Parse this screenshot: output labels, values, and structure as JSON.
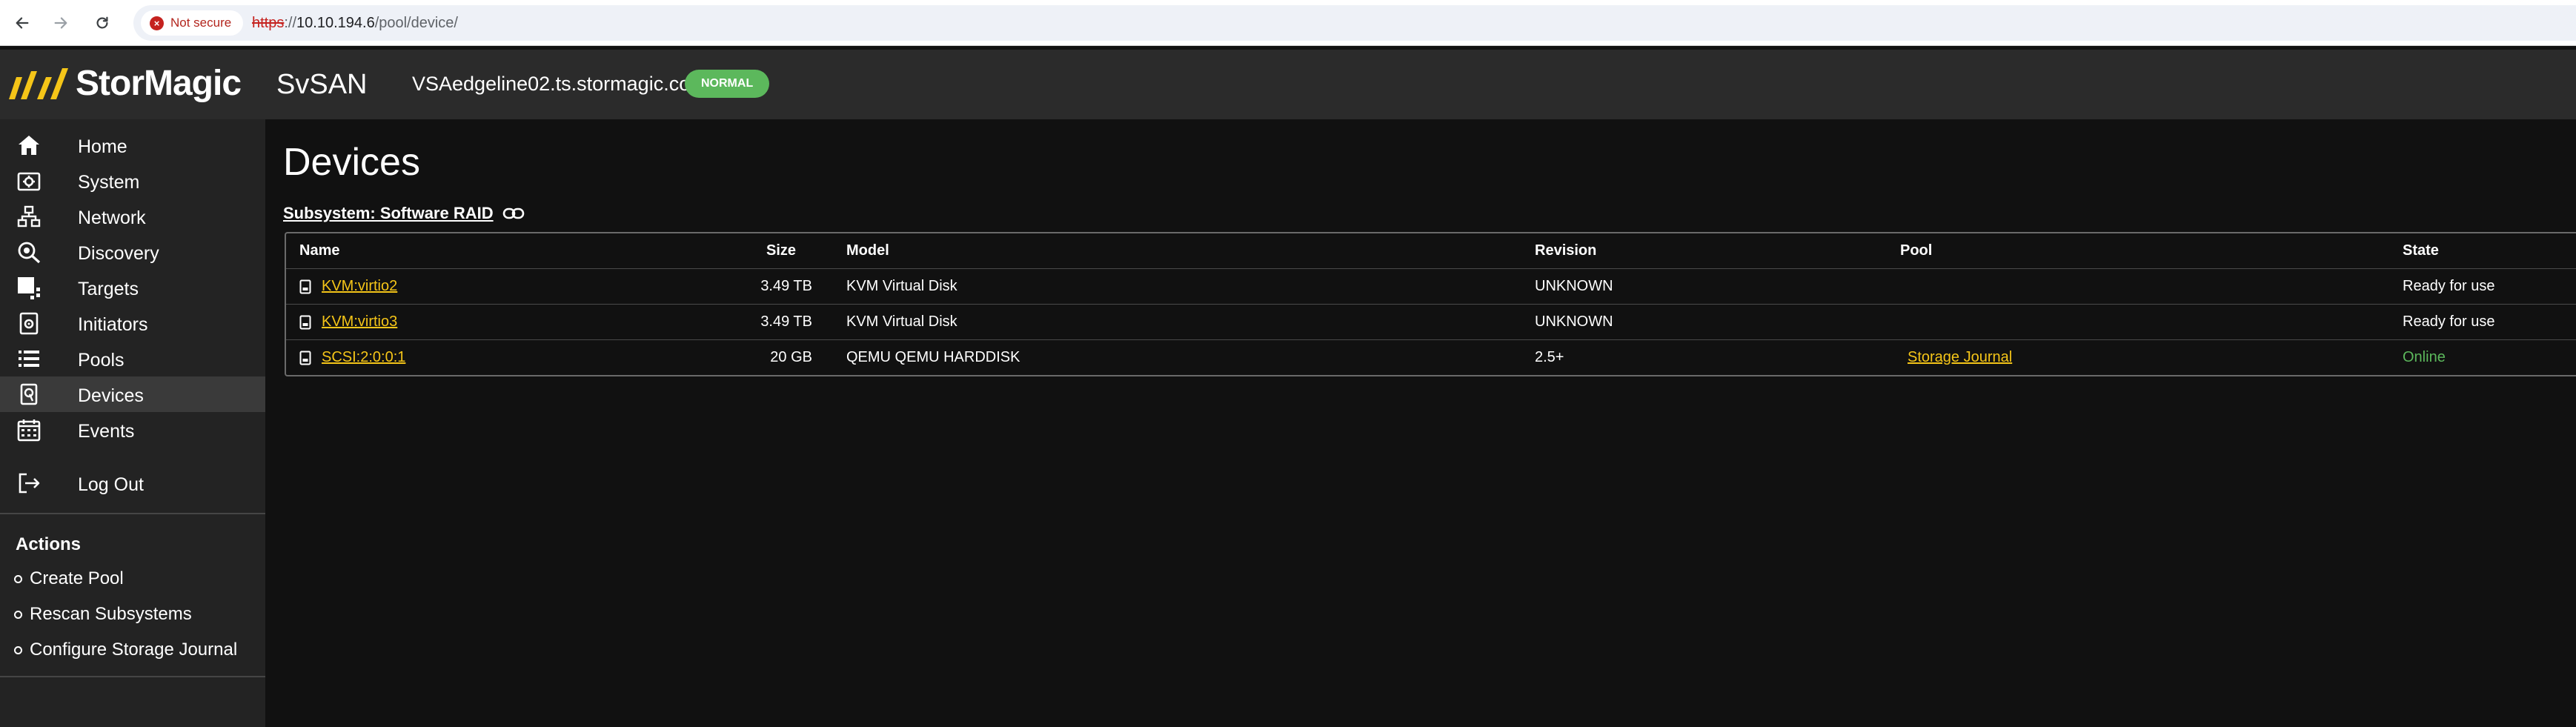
{
  "browser": {
    "security_label": "Not secure",
    "url_scheme": "https",
    "url_sep": "://",
    "url_host": "10.10.194.6",
    "url_path": "/pool/device/"
  },
  "header": {
    "logo_text": "StorMagic",
    "product": "SvSAN",
    "hostname": "VSAedgeline02.ts.stormagic.com",
    "status_badge": "NORMAL"
  },
  "sidebar": {
    "items": [
      {
        "label": "Home",
        "icon": "home-icon"
      },
      {
        "label": "System",
        "icon": "system-icon"
      },
      {
        "label": "Network",
        "icon": "network-icon"
      },
      {
        "label": "Discovery",
        "icon": "discovery-icon"
      },
      {
        "label": "Targets",
        "icon": "targets-icon"
      },
      {
        "label": "Initiators",
        "icon": "initiators-icon"
      },
      {
        "label": "Pools",
        "icon": "pools-icon"
      },
      {
        "label": "Devices",
        "icon": "devices-icon",
        "active": true
      },
      {
        "label": "Events",
        "icon": "events-icon"
      }
    ],
    "logout": {
      "label": "Log Out",
      "icon": "logout-icon"
    },
    "actions_title": "Actions",
    "actions": [
      "Create Pool",
      "Rescan Subsystems",
      "Configure Storage Journal"
    ]
  },
  "main": {
    "title": "Devices",
    "subsystem_label": "Subsystem: Software RAID",
    "table": {
      "columns": [
        "Name",
        "Size",
        "Model",
        "Revision",
        "Pool",
        "State"
      ],
      "rows": [
        {
          "name": "KVM:virtio2",
          "size": "3.49 TB",
          "model": "KVM Virtual Disk",
          "revision": "UNKNOWN",
          "pool": "",
          "state": "Ready for use"
        },
        {
          "name": "KVM:virtio3",
          "size": "3.49 TB",
          "model": "KVM Virtual Disk",
          "revision": "UNKNOWN",
          "pool": "",
          "state": "Ready for use"
        },
        {
          "name": "SCSI:2:0:0:1",
          "size": "20 GB",
          "model": "QEMU QEMU HARDDISK",
          "revision": "2.5+",
          "pool": "Storage Journal",
          "state": "Online"
        }
      ]
    }
  },
  "colors": {
    "accent": "#f5c518",
    "status_green": "#5cb85c",
    "header_bg": "#2b2b2b",
    "sidebar_bg": "#232323",
    "main_bg": "#111111"
  }
}
